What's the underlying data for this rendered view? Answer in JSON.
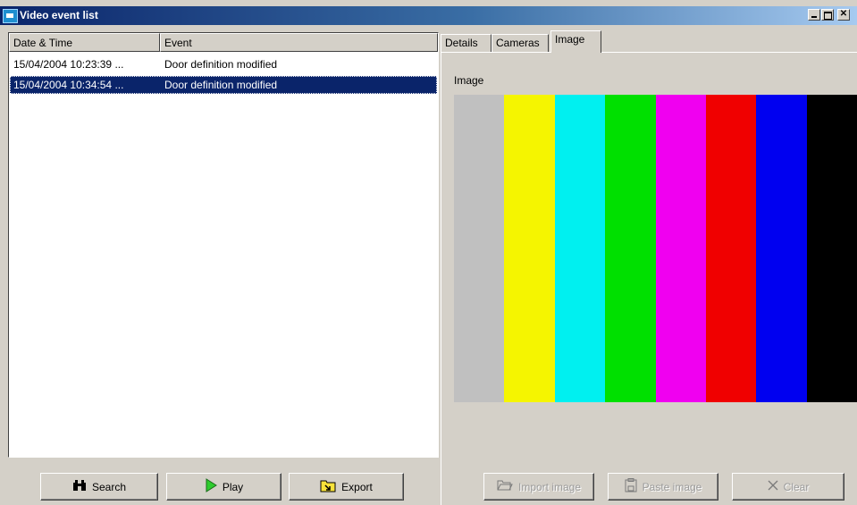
{
  "window": {
    "title": "Video event list"
  },
  "list": {
    "columns": [
      "Date & Time",
      "Event"
    ],
    "rows": [
      {
        "datetime": "15/04/2004 10:23:39 ...",
        "event": "Door definition modified",
        "selected": false
      },
      {
        "datetime": "15/04/2004 10:34:54 ...",
        "event": "Door definition modified",
        "selected": true
      }
    ]
  },
  "buttons": {
    "search": "Search",
    "play": "Play",
    "export": "Export",
    "import_image": "Import image",
    "paste_image": "Paste image",
    "clear": "Clear"
  },
  "tabs": [
    {
      "label": "Details",
      "active": false
    },
    {
      "label": "Cameras",
      "active": false
    },
    {
      "label": "Image",
      "active": true
    }
  ],
  "image_panel": {
    "label": "Image",
    "color_bars": [
      "#c0c0c0",
      "#f5f500",
      "#00f0f0",
      "#00e000",
      "#f000f0",
      "#f00000",
      "#0000f0",
      "#000000"
    ]
  },
  "icons": {
    "app": "app-icon",
    "search": "binoculars-icon",
    "play": "play-icon",
    "export": "export-folder-icon",
    "import": "folder-open-icon",
    "paste": "paste-icon",
    "clear": "x-icon"
  },
  "colors": {
    "selection": "#0a246a",
    "titlebar_start": "#0a246a",
    "titlebar_end": "#a6caf0",
    "face": "#d4d0c8"
  }
}
